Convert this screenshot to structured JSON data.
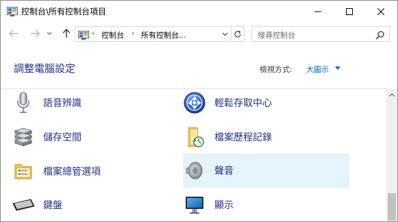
{
  "window": {
    "title": "控制台\\所有控制台項目"
  },
  "nav": {
    "address_segments": [
      "控制台",
      "所有控制台..."
    ],
    "search_placeholder": "搜尋控制台"
  },
  "header": {
    "page_title": "調整電腦設定",
    "view_label": "檢視方式:",
    "view_value": "大圖示"
  },
  "items": [
    {
      "label": "語音辨識",
      "icon": "microphone-icon"
    },
    {
      "label": "輕鬆存取中心",
      "icon": "ease-of-access-icon"
    },
    {
      "label": "儲存空間",
      "icon": "storage-spaces-icon"
    },
    {
      "label": "檔案歷程記錄",
      "icon": "file-history-icon"
    },
    {
      "label": "檔案總管選項",
      "icon": "folder-options-icon"
    },
    {
      "label": "聲音",
      "icon": "speaker-icon"
    },
    {
      "label": "鍵盤",
      "icon": "keyboard-icon"
    },
    {
      "label": "顯示",
      "icon": "monitor-icon"
    }
  ],
  "colors": {
    "link": "#1e3287",
    "accent": "#0066cc",
    "hover_bg": "#e5f3fb"
  }
}
